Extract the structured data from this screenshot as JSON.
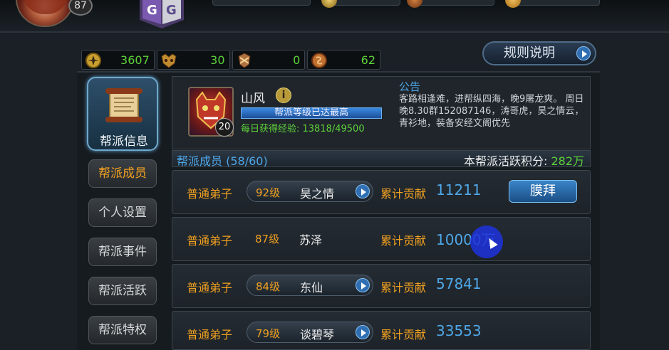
{
  "player": {
    "level": "87"
  },
  "currencies": [
    {
      "icon": "gold-coin-icon",
      "value": "3607"
    },
    {
      "icon": "demon-mask-icon",
      "value": "30"
    },
    {
      "icon": "crest-icon",
      "value": "0"
    },
    {
      "icon": "scroll-token-icon",
      "value": "62"
    }
  ],
  "rules_button": {
    "label": "规则说明"
  },
  "sidebar": {
    "main": {
      "label": "帮派信息"
    },
    "items": [
      {
        "label": "帮派成员",
        "active": true
      },
      {
        "label": "个人设置",
        "active": false
      },
      {
        "label": "帮派事件",
        "active": false
      },
      {
        "label": "帮派活跃",
        "active": false
      },
      {
        "label": "帮派特权",
        "active": false
      }
    ]
  },
  "guild": {
    "name": "山风",
    "emblem_level": "20",
    "level_status": "帮派等级已达最高",
    "daily_exp": "每日获得经验: 13818/49500",
    "notice_title": "公告",
    "notice_body": "客路相逢难，进帮纵四海，晚9屠龙爽。 周日晚8.30群152087146，涛哥虎，昊之情云，青衫地，装备安经文阁优先"
  },
  "members_header": {
    "count": "帮派成员 (58/60)",
    "activity_label": "本帮派活跃积分: ",
    "activity_value": "282万"
  },
  "members": [
    {
      "role": "普通弟子",
      "level": "92级",
      "name": "昊之情",
      "contrib_label": "累计贡献",
      "contrib": "11211",
      "action": "膜拜",
      "has_arrow": true
    },
    {
      "role": "普通弟子",
      "level": "87级",
      "name": "苏泽",
      "contrib_label": "累计贡献",
      "contrib": "10000万",
      "has_arrow": false
    },
    {
      "role": "普通弟子",
      "level": "84级",
      "name": "东仙",
      "contrib_label": "累计贡献",
      "contrib": "57841",
      "has_arrow": true
    },
    {
      "role": "普通弟子",
      "level": "79级",
      "name": "谈碧琴",
      "contrib_label": "累计贡献",
      "contrib": "33553",
      "has_arrow": true
    }
  ]
}
